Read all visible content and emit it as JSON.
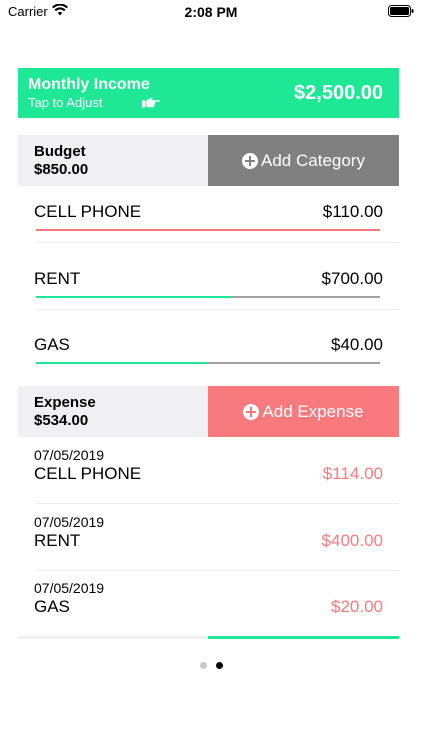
{
  "status_bar": {
    "carrier": "Carrier",
    "time": "2:08 PM",
    "wifi_icon": "wifi-icon",
    "battery_icon": "battery-icon"
  },
  "income": {
    "title": "Monthly Income",
    "subtitle": "Tap to Adjust",
    "amount": "$2,500.00",
    "icon": "hand-pointing-icon",
    "color": "#1ee896"
  },
  "budget": {
    "title": "Budget",
    "amount": "$850.00",
    "add_button": "Add Category",
    "button_color": "#808080",
    "items": [
      {
        "name": "CELL PHONE",
        "amount": "$110.00",
        "progress": 1.0,
        "over": true
      },
      {
        "name": "RENT",
        "amount": "$700.00",
        "progress": 0.57,
        "over": false
      },
      {
        "name": "GAS",
        "amount": "$40.00",
        "progress": 0.5,
        "over": false
      }
    ]
  },
  "expense": {
    "title": "Expense",
    "amount": "$534.00",
    "add_button": "Add Expense",
    "button_color": "#f97a7e",
    "items": [
      {
        "date": "07/05/2019",
        "name": "CELL PHONE",
        "amount": "$114.00"
      },
      {
        "date": "07/05/2019",
        "name": "RENT",
        "amount": "$400.00"
      },
      {
        "date": "07/05/2019",
        "name": "GAS",
        "amount": "$20.00"
      }
    ]
  },
  "pager": {
    "count": 2,
    "active": 1
  }
}
